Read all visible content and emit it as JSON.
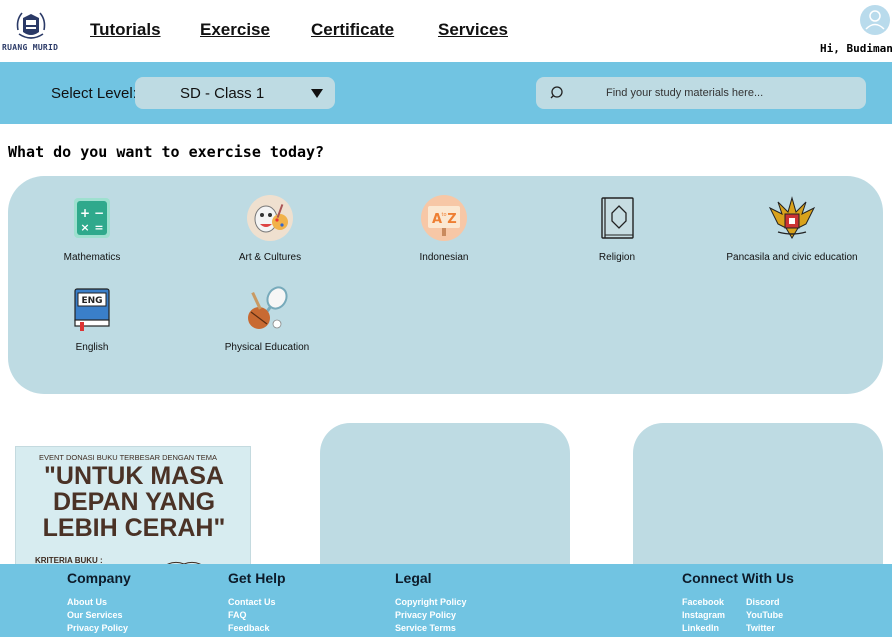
{
  "brand": {
    "logo_text": "RUANG MURID"
  },
  "nav": [
    {
      "label": "Tutorials"
    },
    {
      "label": "Exercise"
    },
    {
      "label": "Certificate"
    },
    {
      "label": "Services"
    }
  ],
  "user": {
    "greeting": "Hi, Budiman"
  },
  "level_bar": {
    "label": "Select Level:",
    "selected": "SD - Class 1",
    "search_placeholder": "Find your study materials here..."
  },
  "section_title": "What do you want to exercise today?",
  "subjects": [
    {
      "label": "Mathematics",
      "icon": "calculator-icon"
    },
    {
      "label": "Art & Cultures",
      "icon": "theater-mask-icon"
    },
    {
      "label": "Indonesian",
      "icon": "a-to-z-icon"
    },
    {
      "label": "Religion",
      "icon": "holy-book-icon"
    },
    {
      "label": "Pancasila and civic education",
      "icon": "garuda-icon"
    },
    {
      "label": "English",
      "icon": "eng-book-icon"
    },
    {
      "label": "Physical Education",
      "icon": "sports-gear-icon"
    }
  ],
  "poster": {
    "top_line": "EVENT DONASI BUKU TERBESAR DENGAN TEMA",
    "headline_1": "\"UNTUK MASA",
    "headline_2": "DEPAN YANG",
    "headline_3": "LEBIH CERAH\"",
    "criteria": "KRITERIA BUKU :"
  },
  "footer": {
    "company": {
      "title": "Company",
      "links": [
        "About Us",
        "Our Services",
        "Privacy Policy"
      ]
    },
    "help": {
      "title": "Get Help",
      "links": [
        "Contact Us",
        "FAQ",
        "Feedback"
      ]
    },
    "legal": {
      "title": "Legal",
      "links": [
        "Copyright Policy",
        "Privacy Policy",
        "Service Terms"
      ]
    },
    "connect": {
      "title": "Connect With Us",
      "links_left": [
        "Facebook",
        "Instagram",
        "LinkedIn"
      ],
      "links_right": [
        "Discord",
        "YouTube",
        "Twitter"
      ]
    }
  },
  "colors": {
    "accent": "#71c4e2",
    "panel": "#bedbe3",
    "footer_link": "#ffffff"
  }
}
